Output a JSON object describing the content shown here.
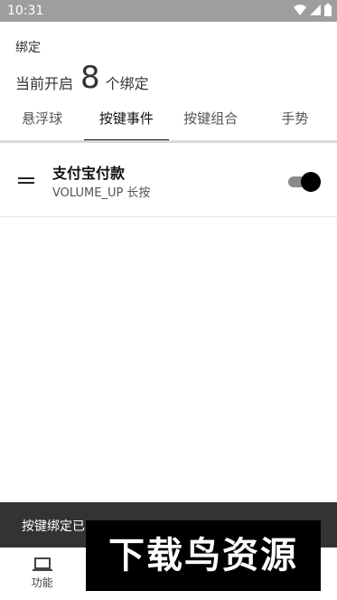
{
  "status_bar": {
    "time": "10:31"
  },
  "header": {
    "small_title": "绑定",
    "count_prefix": "当前开启",
    "count": "8",
    "count_suffix": "个绑定"
  },
  "tabs": [
    {
      "label": "悬浮球"
    },
    {
      "label": "按键事件"
    },
    {
      "label": "按键组合"
    },
    {
      "label": "手势"
    }
  ],
  "active_tab": "按键事件",
  "list": [
    {
      "title": "支付宝付款",
      "subtitle": "VOLUME_UP  长按",
      "enabled": true
    }
  ],
  "snackbar": {
    "message": "按键绑定已",
    "action": ""
  },
  "bottom_nav": [
    {
      "label": "功能",
      "icon": "laptop-icon"
    },
    {
      "label": "",
      "icon": ""
    },
    {
      "label": "",
      "icon": ""
    },
    {
      "label": "",
      "icon": ""
    }
  ],
  "watermark": {
    "text": "下载鸟资源"
  }
}
